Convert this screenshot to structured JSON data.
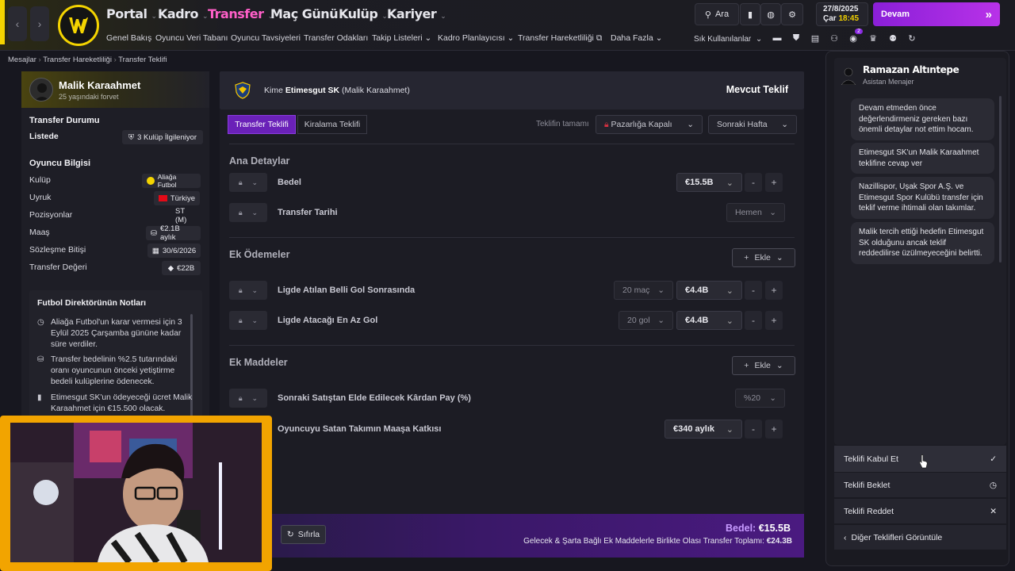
{
  "topbar": {
    "nav": [
      {
        "label": "Portal",
        "active": false
      },
      {
        "label": "Kadro",
        "active": false
      },
      {
        "label": "Transfer",
        "active": true
      },
      {
        "label": "Maç Günü",
        "active": false
      },
      {
        "label": "Kulüp",
        "active": false
      },
      {
        "label": "Kariyer",
        "active": false
      }
    ],
    "subnav": [
      "Genel Bakış",
      "Oyuncu Veri Tabanı",
      "Oyuncu Tavsiyeleri",
      "Transfer Odakları",
      "Takip Listeleri",
      "Kadro Planlayıcısı",
      "Transfer Hareketliliği",
      "Daha Fazla"
    ],
    "search_label": "Ara",
    "date": "27/8/2025",
    "day": "Çar",
    "time": "18:45",
    "continue_label": "Devam",
    "shortcuts_label": "Sık Kullanılanlar",
    "notif_count": "2"
  },
  "breadcrumb": {
    "items": [
      "Mesajlar",
      "Transfer Hareketliliği",
      "Transfer Teklifi"
    ]
  },
  "player": {
    "name": "Malik Karaahmet",
    "desc": "25 yaşındaki forvet",
    "transfer_status_title": "Transfer Durumu",
    "listed_label": "Listede",
    "interest": "3 Kulüp İlgileniyor",
    "info_title": "Oyuncu Bilgisi",
    "rows": [
      {
        "label": "Kulüp",
        "value": "Aliağa Futbol"
      },
      {
        "label": "Uyruk",
        "value": "Türkiye"
      },
      {
        "label": "Pozisyonlar",
        "value": "ST (M)"
      },
      {
        "label": "Maaş",
        "value": "€2.1B aylık"
      },
      {
        "label": "Sözleşme Bitişi",
        "value": "30/6/2026"
      },
      {
        "label": "Transfer Değeri",
        "value": "€22B"
      }
    ],
    "notes_title": "Futbol Direktörünün Notları",
    "notes": [
      "Aliağa Futbol'un karar vermesi için 3 Eylül 2025 Çarşamba gününe kadar süre verdiler.",
      "Transfer bedelinin %2.5 tutarındaki oranı oyuncunun önceki yetiştirme bedeli kulüplerine ödenecek.",
      "Etimesgut SK'un ödeyeceği ücret Malik Karaahmet için €15.500 olacak."
    ]
  },
  "offer": {
    "to_prefix": "Kime",
    "club": "Etimesgut SK",
    "person": "(Malik Karaahmet)",
    "current_label": "Mevcut Teklif",
    "tabs": [
      "Transfer Teklifi",
      "Kiralama Teklifi"
    ],
    "complete_label": "Teklifin tamamı",
    "negotiation": "Pazarlığa Kapalı",
    "next_week": "Sonraki Hafta",
    "main_section": "Ana Detaylar",
    "fee_label": "Bedel",
    "fee_value": "€15.5B",
    "date_label": "Transfer Tarihi",
    "date_value": "Hemen",
    "extra_section": "Ek Ödemeler",
    "add_label": "Ekle",
    "extra1_label": "Ligde Atılan Belli Gol Sonrasında",
    "extra1_cond": "20 maç",
    "extra1_value": "€4.4B",
    "extra2_label": "Ligde Atacağı En Az Gol",
    "extra2_cond": "20 gol",
    "extra2_value": "€4.4B",
    "clauses_section": "Ek Maddeler",
    "clause1_label": "Sonraki Satıştan Elde Edilecek Kârdan Pay (%)",
    "clause1_value": "%20",
    "clause2_label": "Oyuncuyu Satan Takımın Maaşa Katkısı",
    "clause2_value": "€340 aylık",
    "reset_label": "Sıfırla",
    "footer_fee_label": "Bedel:",
    "footer_fee": "€15.5B",
    "footer_total_text": "Gelecek & Şarta Bağlı Ek Maddelerle Birlikte Olası Transfer Toplamı:",
    "footer_total": "€24.3B"
  },
  "assistant": {
    "name": "Ramazan Altıntepe",
    "role": "Asistan Menajer",
    "messages": [
      "Devam etmeden önce değerlendirmeniz gereken bazı önemli detaylar not ettim hocam.",
      "Etimesgut SK'un Malik Karaahmet teklifine cevap ver",
      "Nazillispor, Uşak Spor A.Ş. ve Etimesgut Spor Kulübü transfer için teklif verme ihtimali olan takımlar.",
      "Malik tercih ettiği hedefin Etimesgut SK olduğunu ancak teklif reddedilirse üzülmeyeceğini belirtti."
    ],
    "actions": [
      "Teklifi Kabul Et",
      "Teklifi Beklet",
      "Teklifi Reddet",
      "Diğer Teklifleri Görüntüle"
    ]
  },
  "colors": {
    "accent": "#f4d400",
    "transfer_nav": "#ff5fc8",
    "primary_purple": "#6a21b8"
  }
}
